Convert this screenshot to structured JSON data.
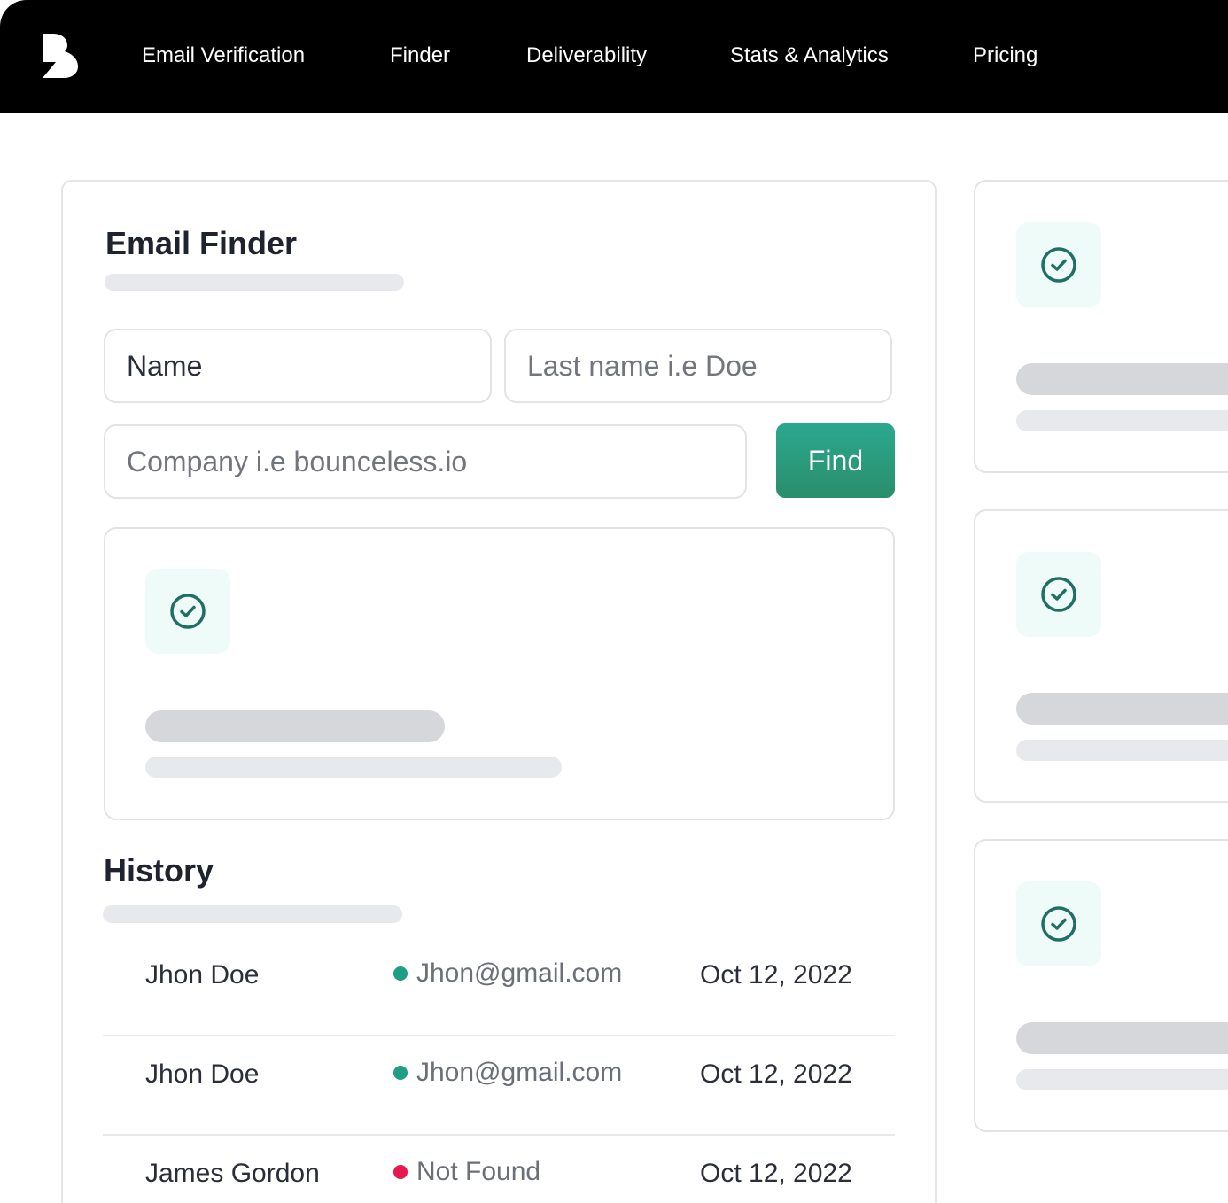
{
  "nav": {
    "logo_icon": "bounceless-logo-icon",
    "items": [
      {
        "label": "Email Verification"
      },
      {
        "label": "Finder"
      },
      {
        "label": "Deliverability"
      },
      {
        "label": "Stats & Analytics"
      },
      {
        "label": "Pricing"
      }
    ]
  },
  "finder": {
    "title": "Email Finder",
    "name_value": "Name",
    "last_name_placeholder": "Last name i.e Doe",
    "company_placeholder": "Company i.e bounceless.io",
    "find_label": "Find",
    "result_icon": "check-circle-icon"
  },
  "history": {
    "title": "History",
    "rows": [
      {
        "name": "Jhon Doe",
        "email": "Jhon@gmail.com",
        "status": "found",
        "date": "Oct 12, 2022"
      },
      {
        "name": "Jhon Doe",
        "email": "Jhon@gmail.com",
        "status": "found",
        "date": "Oct 12, 2022"
      },
      {
        "name": "James Gordon",
        "email": "Not Found",
        "status": "not-found",
        "date": "Oct 12, 2022"
      }
    ]
  },
  "side_cards": {
    "icon": "check-circle-icon"
  },
  "colors": {
    "brand_green": "#2a9a7b",
    "icon_stroke": "#1f6f64",
    "status_ok": "#1f9e83",
    "status_bad": "#e5194d"
  }
}
